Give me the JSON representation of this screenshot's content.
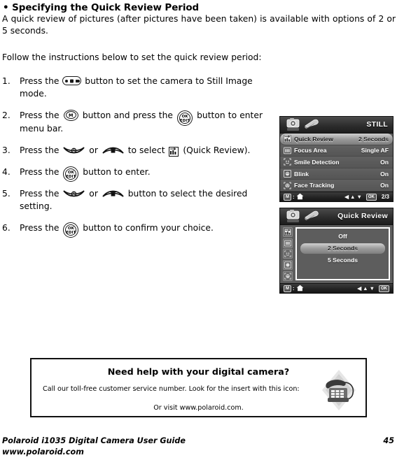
{
  "section": {
    "bullet": "•",
    "title": "Specifying the Quick Review Period",
    "intro": "A quick review of pictures (after pictures have been taken) is available with options of 2 or 5 seconds.",
    "follow": "Follow the instructions below to set the quick review period:"
  },
  "steps": [
    {
      "num": "1.",
      "pre": "Press the",
      "icon": "mode-button-icon",
      "post": "button to set the camera to Still Image mode.",
      "justify": false
    },
    {
      "num": "2.",
      "pre": "Press the",
      "icon": "menu-button-icon",
      "mid": "button and press the",
      "icon2": "ok-edit-button-icon",
      "post": "button to enter menu bar.",
      "justify": true
    },
    {
      "num": "3.",
      "pre": "Press the",
      "icon": "self-timer-up-button-icon",
      "mid": "or",
      "icon2": "delete-down-button-icon",
      "mid2": "to select",
      "icon3": "quick-review-icon",
      "post": "(Quick Review).",
      "justify": false
    },
    {
      "num": "4.",
      "pre": "Press the",
      "icon": "ok-edit-button-icon",
      "post": "button to enter.",
      "justify": false
    },
    {
      "num": "5.",
      "pre": "Press the",
      "icon": "self-timer-up-button-icon",
      "mid": "or",
      "icon2": "delete-down-button-icon",
      "post": "button to select the desired setting.",
      "justify": false
    },
    {
      "num": "6.",
      "pre": "Press the",
      "icon": "ok-edit-button-icon",
      "post": "button to confirm your choice.",
      "justify": true
    }
  ],
  "lcd_still": {
    "title": "STILL",
    "tab_icons": [
      "camera-settings-icon",
      "wrench-setup-icon"
    ],
    "menu_rows": [
      {
        "icon": "quick-review-icon",
        "label": "Quick Review",
        "value": "2 Seconds",
        "selected": true
      },
      {
        "icon": "focus-area-icon",
        "label": "Focus Area",
        "value": "Single AF",
        "selected": false
      },
      {
        "icon": "smile-detection-icon",
        "label": "Smile Detection",
        "value": "On",
        "selected": false
      },
      {
        "icon": "blink-icon",
        "label": "Blink",
        "value": "On",
        "selected": false
      },
      {
        "icon": "face-tracking-icon",
        "label": "Face Tracking",
        "value": "On",
        "selected": false
      }
    ],
    "bottom": {
      "menu_badge": "M",
      "home_icon": "home-icon",
      "separator": ":",
      "arrow_left": "◀",
      "arrow_up": "▲",
      "arrow_down": "▼",
      "ok_badge": "OK",
      "page": "2/3"
    }
  },
  "lcd_quick": {
    "title": "Quick Review",
    "tab_icons": [
      "camera-settings-icon",
      "wrench-setup-icon"
    ],
    "rail_icons": [
      "quick-review-icon",
      "focus-area-icon",
      "smile-detection-icon",
      "blink-icon",
      "face-tracking-icon"
    ],
    "options": [
      {
        "label": "Off",
        "selected": false
      },
      {
        "label": "2 Seconds",
        "selected": true
      },
      {
        "label": "5 Seconds",
        "selected": false
      }
    ],
    "bottom": {
      "menu_badge": "M",
      "home_icon": "home-icon",
      "separator": ":",
      "arrow_left": "◀",
      "arrow_up": "▲",
      "arrow_down": "▼",
      "ok_badge": "OK"
    }
  },
  "help": {
    "title": "Need help with your digital camera?",
    "line": "Call our toll-free customer service number. Look for the insert with this icon:",
    "visit": "Or visit www.polaroid.com.",
    "icon": "telephone-icon"
  },
  "footer": {
    "guide": "Polaroid i1035 Digital Camera User Guide",
    "site": "www.polaroid.com",
    "page": "45"
  },
  "colors": {
    "ink": "#111111",
    "lcd_bg": "#5d5d5d",
    "lcd_header": "#2d2d2d",
    "lcd_selected": "#b5b5b5"
  }
}
